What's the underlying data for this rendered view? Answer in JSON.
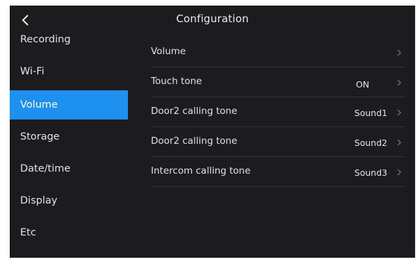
{
  "header": {
    "title": "Configuration",
    "back_icon": "chevron-left-icon"
  },
  "sidebar": {
    "items": [
      {
        "label": "Recording",
        "active": false
      },
      {
        "label": "Wi-Fi",
        "active": false
      },
      {
        "label": "Volume",
        "active": true
      },
      {
        "label": "Storage",
        "active": false
      },
      {
        "label": "Date/time",
        "active": false
      },
      {
        "label": "Display",
        "active": false
      },
      {
        "label": "Etc",
        "active": false
      }
    ]
  },
  "settings": {
    "rows": [
      {
        "label": "Volume",
        "value": ""
      },
      {
        "label": "Touch tone",
        "value": "ON"
      },
      {
        "label": "Door2 calling tone",
        "value": "Sound1"
      },
      {
        "label": "Door2 calling tone",
        "value": "Sound2"
      },
      {
        "label": "Intercom calling tone",
        "value": "Sound3"
      }
    ]
  },
  "colors": {
    "background": "#1c1c1e",
    "accent": "#1e90f0",
    "divider": "#353538",
    "chevron": "#6e6e72"
  }
}
